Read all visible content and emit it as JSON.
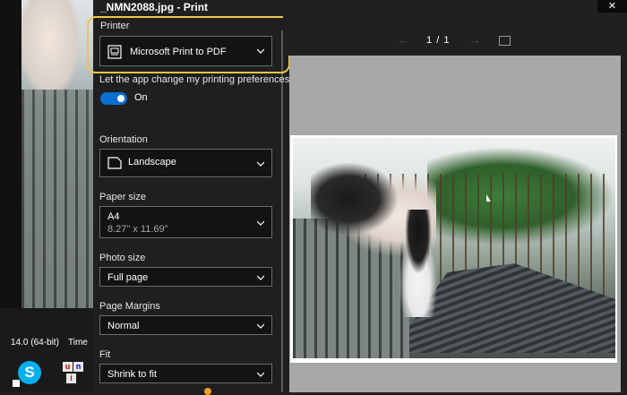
{
  "window": {
    "title": "_NMN2088.jpg - Print",
    "close_glyph": "✕"
  },
  "printer": {
    "label": "Printer",
    "value": "Microsoft Print to PDF",
    "icon": "printer-icon"
  },
  "preferences": {
    "label": "Let the app change my printing preferences",
    "toggle_state": "On"
  },
  "orientation": {
    "label": "Orientation",
    "value": "Landscape",
    "icon": "page-landscape-icon"
  },
  "paper_size": {
    "label": "Paper size",
    "value": "A4",
    "detail": "8.27\" x 11.69\""
  },
  "photo_size": {
    "label": "Photo size",
    "value": "Full page"
  },
  "page_margins": {
    "label": "Page Margins",
    "value": "Normal"
  },
  "fit": {
    "label": "Fit",
    "value": "Shrink to fit"
  },
  "preview": {
    "page_current": "1",
    "page_separator": "/",
    "page_total": "1",
    "prev_glyph": "←",
    "next_glyph": "→"
  },
  "taskbar": {
    "version_text": "14.0 (64-bit)",
    "time_text": "Time",
    "skype_letter": "S",
    "unikey_letters": [
      "u",
      "n",
      "i"
    ]
  },
  "colors": {
    "accent": "#0a6fd0",
    "highlight": "#f0c64a",
    "background": "#1f1f1f",
    "preview_bg": "#a8a8a8"
  }
}
